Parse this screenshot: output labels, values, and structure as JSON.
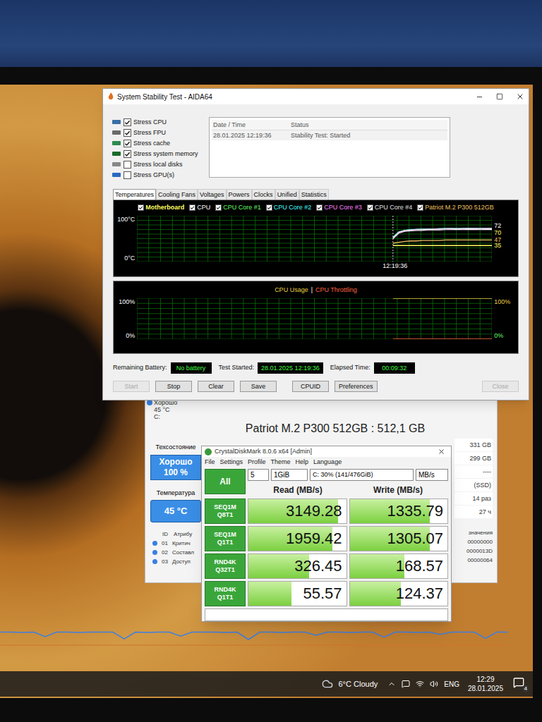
{
  "aida": {
    "title": "System Stability Test - AIDA64",
    "stress": [
      {
        "label": "Stress CPU",
        "checked": true
      },
      {
        "label": "Stress FPU",
        "checked": true
      },
      {
        "label": "Stress cache",
        "checked": true
      },
      {
        "label": "Stress system memory",
        "checked": true
      },
      {
        "label": "Stress local disks",
        "checked": false
      },
      {
        "label": "Stress GPU(s)",
        "checked": false
      }
    ],
    "log": {
      "columns": [
        "Date / Time",
        "Status"
      ],
      "rows": [
        [
          "28.01.2025 12:19:36",
          "Stability Test: Started"
        ]
      ]
    },
    "tabs": [
      {
        "label": "Temperatures",
        "selected": true
      },
      {
        "label": "Cooling Fans",
        "selected": false
      },
      {
        "label": "Voltages",
        "selected": false
      },
      {
        "label": "Powers",
        "selected": false
      },
      {
        "label": "Clocks",
        "selected": false
      },
      {
        "label": "Unified",
        "selected": false
      },
      {
        "label": "Statistics",
        "selected": false
      }
    ],
    "temp_chart": {
      "y_top": "100°C",
      "y_bottom": "0°C",
      "time": "12:19:36",
      "legend": [
        {
          "label": "Motherboard",
          "checked": true,
          "color": "#ffff60",
          "values": [
            35,
            35,
            35,
            35,
            35,
            35,
            35,
            35,
            35,
            35,
            35,
            35,
            35,
            35,
            35,
            35,
            35,
            35
          ]
        },
        {
          "label": "CPU",
          "checked": true,
          "color": "#ffffff",
          "values": [
            50,
            62,
            66,
            67,
            68,
            68,
            69,
            69,
            69,
            70,
            70,
            70,
            70,
            70,
            70,
            70,
            70,
            70
          ]
        },
        {
          "label": "CPU Core #1",
          "checked": true,
          "color": "#60ff60",
          "values": [
            52,
            64,
            68,
            69,
            70,
            70,
            71,
            71,
            71,
            71,
            72,
            72,
            72,
            72,
            72,
            72,
            72,
            72
          ]
        },
        {
          "label": "CPU Core #2",
          "checked": true,
          "color": "#40ffff",
          "values": [
            53,
            65,
            68,
            70,
            70,
            71,
            71,
            71,
            72,
            72,
            72,
            72,
            72,
            73,
            72,
            72,
            72,
            72
          ]
        },
        {
          "label": "CPU Core #3",
          "checked": true,
          "color": "#ff80ff",
          "values": [
            51,
            63,
            67,
            69,
            69,
            70,
            70,
            71,
            71,
            71,
            71,
            72,
            71,
            72,
            72,
            71,
            72,
            72
          ]
        },
        {
          "label": "CPU Core #4",
          "checked": true,
          "color": "#e0e0e0",
          "values": [
            52,
            64,
            68,
            69,
            70,
            70,
            70,
            71,
            71,
            72,
            72,
            71,
            72,
            72,
            72,
            72,
            72,
            72
          ]
        },
        {
          "label": "Patriot M.2 P300 512GB",
          "checked": true,
          "color": "#f0c060",
          "values": [
            40,
            42,
            44,
            45,
            45,
            46,
            46,
            46,
            46,
            47,
            47,
            47,
            47,
            47,
            47,
            47,
            47,
            47
          ]
        }
      ],
      "readings": [
        {
          "text": "72",
          "color": "#ffffff"
        },
        {
          "text": "70",
          "color": "#ffff60"
        },
        {
          "text": "47",
          "color": "#f0c060"
        },
        {
          "text": "35",
          "color": "#ffff60"
        }
      ]
    },
    "usage_chart": {
      "separator": "|",
      "y_top": "100%",
      "y_bottom": "0%",
      "right_top": "100%",
      "right_bottom": "0%",
      "series": [
        {
          "label": "CPU Usage",
          "color": "#e8d040",
          "values": [
            100,
            100,
            100,
            100,
            100,
            100,
            100,
            100,
            100,
            100,
            100,
            100,
            100,
            100,
            100,
            100,
            100,
            100
          ]
        },
        {
          "label": "CPU Throttling",
          "color": "#ff6040",
          "values": [
            0,
            0,
            0,
            0,
            0,
            0,
            0,
            0,
            0,
            0,
            0,
            0,
            0,
            0,
            0,
            0,
            0,
            0
          ]
        }
      ]
    },
    "status": [
      {
        "label": "Remaining Battery:",
        "value": "No battery"
      },
      {
        "label": "Test Started:",
        "value": "28.01.2025 12:19:36"
      },
      {
        "label": "Elapsed Time:",
        "value": "00:09:32"
      }
    ],
    "buttons": [
      {
        "label": "Start",
        "disabled": true
      },
      {
        "label": "Stop",
        "disabled": false
      },
      {
        "label": "Clear",
        "disabled": false
      },
      {
        "label": "Save",
        "disabled": false
      },
      {
        "label": "CPUID",
        "disabled": false
      },
      {
        "label": "Preferences",
        "disabled": false
      },
      {
        "label": "Close",
        "disabled": true
      }
    ]
  },
  "diskinfo": {
    "drive_status": "Хорошо",
    "drive_temp": "45 °C",
    "drive_letter": "C:",
    "title": "Patriot M.2 P300 512GB : 512,1 GB",
    "health_label": "Техсостояние",
    "health": "Хорошо",
    "health_percent": "100 %",
    "temp_label": "Температура",
    "temp": "45 °C",
    "right_values": [
      "331 GB",
      "299 GB",
      "----",
      "(SSD)",
      "14 раз",
      "27 ч"
    ],
    "attr_columns": [
      "ID",
      "Атрибу"
    ],
    "attr_value_column": "значения",
    "attributes": [
      {
        "id": "01",
        "name": "Критич",
        "value": "00000000"
      },
      {
        "id": "02",
        "name": "Составл",
        "value": "0000013D"
      },
      {
        "id": "03",
        "name": "Доступ",
        "value": "00000064"
      }
    ]
  },
  "diskmark": {
    "title": "CrystalDiskMark 8.0.6 x64 [Admin]",
    "menu": [
      "File",
      "Settings",
      "Profile",
      "Theme",
      "Help",
      "Language"
    ],
    "all_button": "All",
    "count": "5",
    "size": "1GiB",
    "drive": "C: 30% (141/476GiB)",
    "unit": "MB/s",
    "columns": [
      "Read (MB/s)",
      "Write (MB/s)"
    ],
    "rows": [
      {
        "test": "SEQ1M",
        "params": "Q8T1",
        "read": "3149.28",
        "read_level": 0.92,
        "write": "1335.79",
        "write_level": 0.82
      },
      {
        "test": "SEQ1M",
        "params": "Q1T1",
        "read": "1959.42",
        "read_level": 0.86,
        "write": "1305.07",
        "write_level": 0.82
      },
      {
        "test": "RND4K",
        "params": "Q32T1",
        "read": "326.45",
        "read_level": 0.62,
        "write": "168.57",
        "write_level": 0.56
      },
      {
        "test": "RND4K",
        "params": "Q1T1",
        "read": "55.57",
        "read_level": 0.44,
        "write": "124.37",
        "write_level": 0.52
      }
    ]
  },
  "background_graph": {
    "values": [
      96,
      96,
      95,
      96,
      80,
      96,
      96,
      95,
      96,
      96,
      96,
      72,
      96,
      95,
      96,
      96,
      82,
      96,
      96,
      96,
      95,
      96,
      70,
      96,
      96,
      95,
      96,
      96,
      85,
      96,
      96,
      95,
      96,
      96,
      78,
      96,
      96,
      95,
      96,
      88,
      96,
      96,
      96,
      74,
      96,
      96
    ]
  },
  "taskbar": {
    "weather": "6°C Cloudy",
    "language": "ENG",
    "time": "12:29",
    "date": "28.01.2025",
    "notifications": "4"
  }
}
